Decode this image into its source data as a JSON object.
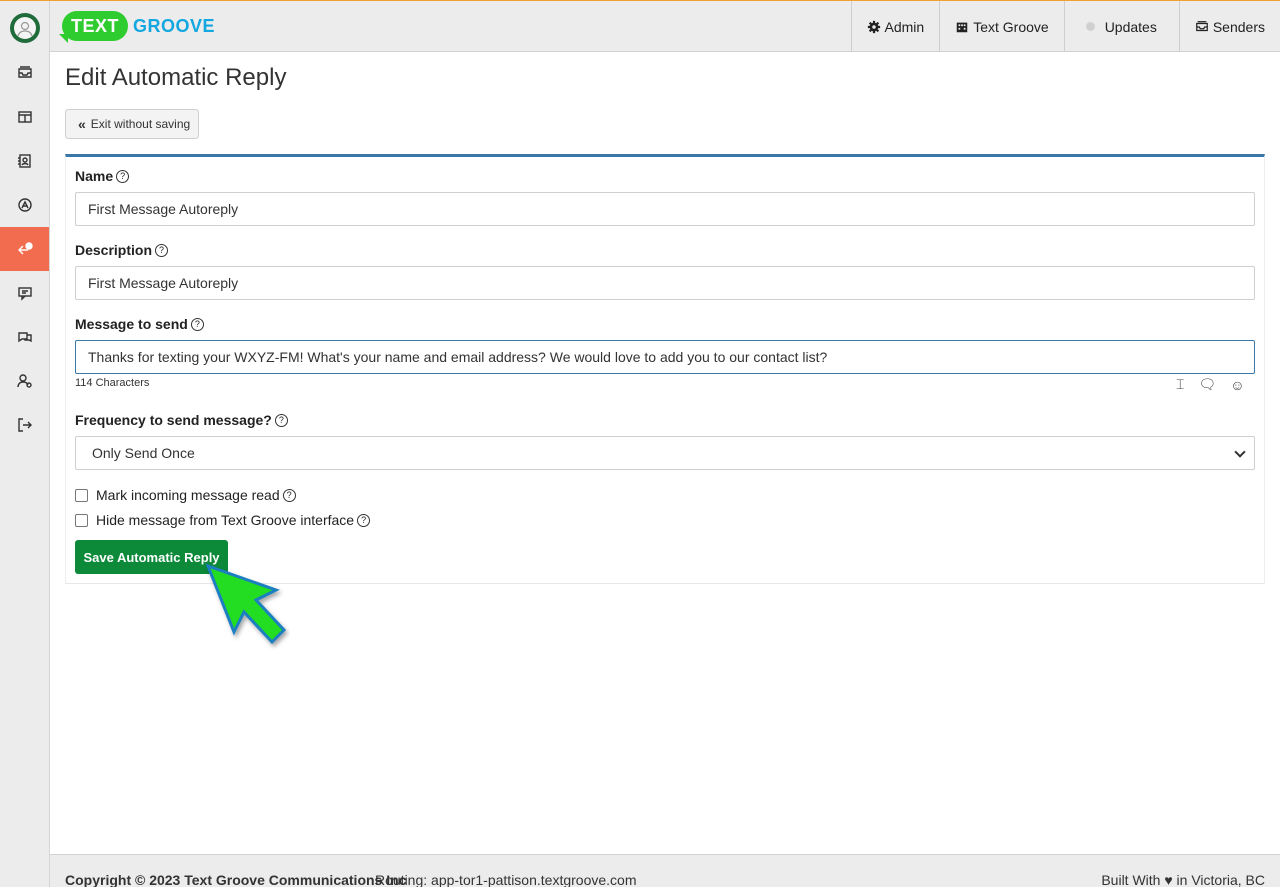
{
  "header": {
    "logo_text": "TEXT",
    "logo_word": "GROOVE",
    "nav": [
      {
        "label": "Admin",
        "icon": "gear-icon"
      },
      {
        "label": "Text Groove",
        "icon": "building-icon"
      },
      {
        "label": "Updates",
        "icon": "dot-icon"
      },
      {
        "label": "Senders",
        "icon": "inbox-icon"
      }
    ]
  },
  "sidebar": {
    "items": [
      {
        "icon": "inbox-icon",
        "active": false
      },
      {
        "icon": "layout-icon",
        "active": false
      },
      {
        "icon": "contacts-icon",
        "active": false
      },
      {
        "icon": "compass-icon",
        "active": false
      },
      {
        "icon": "auto-reply-icon",
        "active": true
      },
      {
        "icon": "message-icon",
        "active": false
      },
      {
        "icon": "chat-icon",
        "active": false
      },
      {
        "icon": "user-settings-icon",
        "active": false
      },
      {
        "icon": "logout-icon",
        "active": false
      }
    ]
  },
  "page": {
    "title": "Edit Automatic Reply",
    "exit_label": "Exit without saving"
  },
  "form": {
    "name_label": "Name",
    "name_value": "First Message Autoreply",
    "description_label": "Description",
    "description_value": "First Message Autoreply",
    "message_label": "Message to send",
    "message_value": "Thanks for texting your WXYZ-FM! What's your name and email address? We would love to add you to our contact list?",
    "char_count": "114 Characters",
    "frequency_label": "Frequency to send message?",
    "frequency_value": "Only Send Once",
    "mark_read_label": "Mark incoming message read",
    "hide_label": "Hide message from Text Groove interface",
    "save_label": "Save Automatic Reply"
  },
  "footer": {
    "copyright": "Copyright © 2023 Text Groove Communications Inc",
    "routing": "Routing: app-tor1-pattison.textgroove.com",
    "built_prefix": "Built With",
    "built_suffix": "in Victoria, BC"
  },
  "colors": {
    "accent_orange": "#f26d4f",
    "brand_green": "#2ecc2e",
    "brand_blue": "#12a7e0",
    "save_green": "#0c8a3a",
    "card_border": "#3a78a8"
  }
}
